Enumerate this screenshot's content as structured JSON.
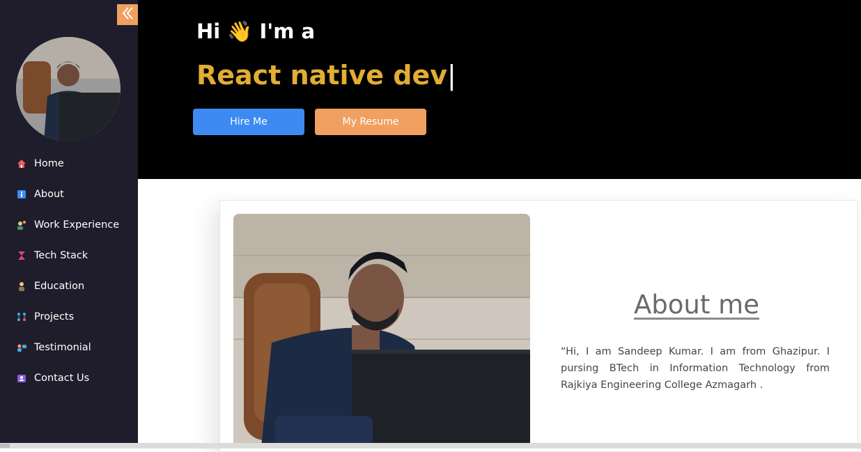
{
  "sidebar": {
    "collapse_icon": "double-chevron-left-icon",
    "nav": [
      {
        "label": "Home",
        "icon": "home-icon",
        "color": "#e85d5d"
      },
      {
        "label": "About",
        "icon": "info-icon",
        "color": "#3d8bf2"
      },
      {
        "label": "Work Experience",
        "icon": "worker-icon",
        "color": "#f0a060"
      },
      {
        "label": "Tech Stack",
        "icon": "hourglass-icon",
        "color": "#e0408a"
      },
      {
        "label": "Education",
        "icon": "student-icon",
        "color": "#f0c080"
      },
      {
        "label": "Projects",
        "icon": "flow-icon",
        "color": "#4aa8e0"
      },
      {
        "label": "Testimonial",
        "icon": "people-icon",
        "color": "#f0a060"
      },
      {
        "label": "Contact Us",
        "icon": "contact-card-icon",
        "color": "#8a5cd8"
      }
    ]
  },
  "hero": {
    "greeting": "Hi",
    "wave": "👋",
    "greeting_suffix": "I'm a",
    "role": "React native dev",
    "cursor": "|",
    "hire_button": "Hire Me",
    "resume_button": "My Resume"
  },
  "about": {
    "title": "About me",
    "text": "“Hi, I am Sandeep Kumar. I am from Ghazipur. I pursing BTech in Information Technology from Rajkiya Engineering College Azmagarh ."
  },
  "colors": {
    "sidebar_bg": "#1f1d2b",
    "accent_orange": "#f0a060",
    "accent_blue": "#3d8bf2",
    "role_gold": "#e2ad32"
  }
}
